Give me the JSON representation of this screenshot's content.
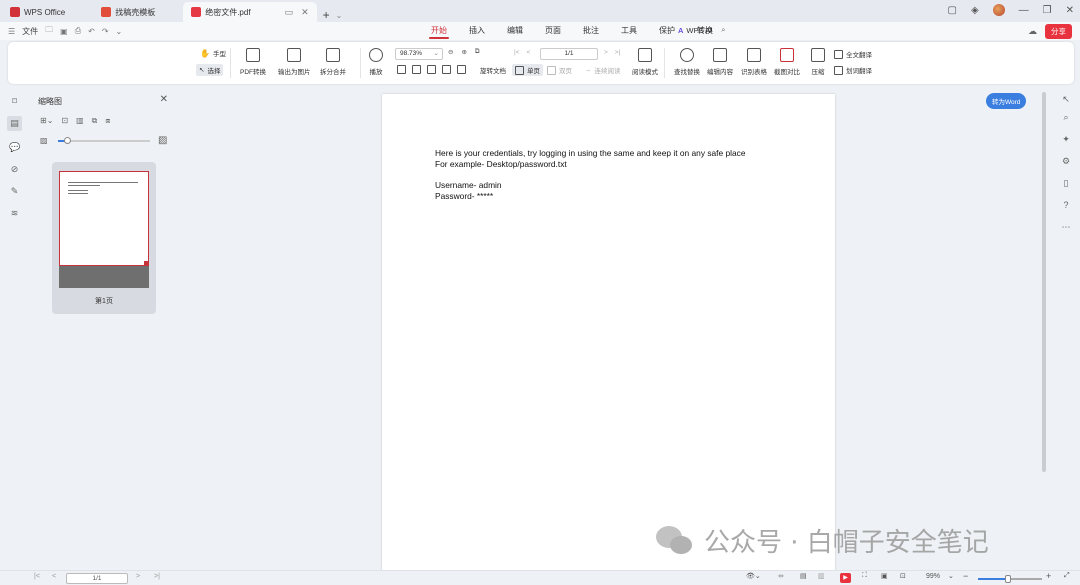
{
  "tabs": [
    {
      "label": "WPS Office",
      "color": "#d1323a"
    },
    {
      "label": "找稿壳模板",
      "color": "#e24c3a"
    },
    {
      "label": "绝密文件.pdf",
      "color": "#e53945"
    }
  ],
  "menu": {
    "file": "文件",
    "ribbon_tabs": [
      "开始",
      "插入",
      "编辑",
      "页面",
      "批注",
      "工具",
      "保护",
      "转换"
    ],
    "active_tab": "开始",
    "wps_ai": "WPS AI",
    "share": "分享"
  },
  "ribbon": {
    "hand": "手型",
    "select": "选择",
    "pdf_convert": "PDF转换",
    "export_image": "输出为图片",
    "split_merge": "拆分合并",
    "play": "播放",
    "zoom": "98.73%",
    "rotate": "旋转文档",
    "single_page": "单页",
    "double_page": "双页",
    "continuous": "连续阅读",
    "read_mode": "阅读模式",
    "page_field": "1/1",
    "find_replace": "查找替换",
    "edit_content": "编辑内容",
    "recognize_table": "识别表格",
    "screenshot_compare": "截图对比",
    "compress": "压缩",
    "full_translate": "全文翻译",
    "word_translate": "划词翻译"
  },
  "thumbnail_panel": {
    "title": "缩略图",
    "page_label": "第1页",
    "slider_fraction": 0.1
  },
  "document": {
    "lines": [
      "Here is your credentials, try logging in using the same and keep it on any safe place",
      "For example- Desktop/password.txt",
      "Username- admin",
      "Password- *****"
    ],
    "to_word": "转为Word"
  },
  "statusbar": {
    "page": "1/1",
    "zoom": "99%",
    "zoom_fraction": 0.47
  },
  "watermark": "公众号 · 白帽子安全笔记"
}
